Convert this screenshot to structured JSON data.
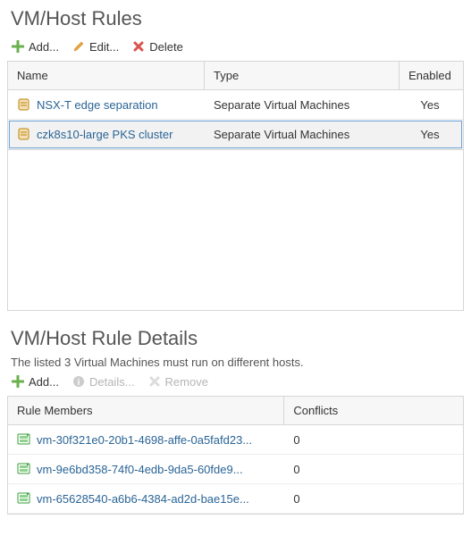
{
  "rules": {
    "title": "VM/Host Rules",
    "toolbar": {
      "add": "Add...",
      "edit": "Edit...",
      "delete": "Delete"
    },
    "columns": {
      "name": "Name",
      "type": "Type",
      "enabled": "Enabled"
    },
    "rows": [
      {
        "name": "NSX-T edge separation",
        "type": "Separate Virtual Machines",
        "enabled": "Yes",
        "selected": false
      },
      {
        "name": "czk8s10-large PKS cluster",
        "type": "Separate Virtual Machines",
        "enabled": "Yes",
        "selected": true
      }
    ]
  },
  "details": {
    "title": "VM/Host Rule Details",
    "subtext": "The listed 3 Virtual Machines must run on different hosts.",
    "toolbar": {
      "add": "Add...",
      "detailsBtn": "Details...",
      "remove": "Remove"
    },
    "columns": {
      "member": "Rule Members",
      "conflicts": "Conflicts"
    },
    "rows": [
      {
        "name": "vm-30f321e0-20b1-4698-affe-0a5fafd23...",
        "conflicts": "0"
      },
      {
        "name": "vm-9e6bd358-74f0-4edb-9da5-60fde9...",
        "conflicts": "0"
      },
      {
        "name": "vm-65628540-a6b6-4384-ad2d-bae15e...",
        "conflicts": "0"
      }
    ]
  }
}
